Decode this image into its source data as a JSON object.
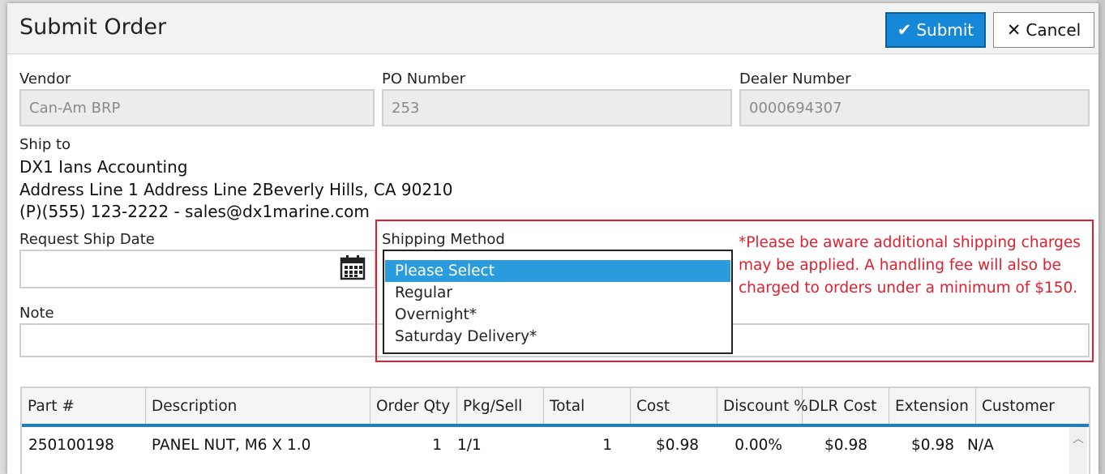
{
  "dialog": {
    "title": "Submit Order"
  },
  "buttons": {
    "submit": "Submit",
    "cancel": "Cancel"
  },
  "vendor": {
    "label": "Vendor",
    "value": "Can-Am BRP"
  },
  "po": {
    "label": "PO Number",
    "value": "253"
  },
  "dealer": {
    "label": "Dealer Number",
    "value": "0000694307"
  },
  "ship_to": {
    "label": "Ship to",
    "name": "DX1 Ians Accounting",
    "address": "Address Line 1 Address Line 2Beverly Hills, CA 90210",
    "contact": "(P)(555) 123-2222 - sales@dx1marine.com"
  },
  "request_ship_date": {
    "label": "Request Ship Date",
    "value": ""
  },
  "shipping_method": {
    "label": "Shipping Method",
    "options": [
      "Please Select",
      "Regular",
      "Overnight*",
      "Saturday Delivery*"
    ],
    "selected": "Please Select"
  },
  "notice": "*Please be aware additional shipping charges may be applied. A handling fee will also be charged to orders under a minimum of $150.",
  "note": {
    "label": "Note",
    "value": ""
  },
  "table": {
    "columns": [
      "Part #",
      "Description",
      "Order Qty",
      "Pkg/Sell",
      "Total",
      "Cost",
      "Discount %",
      "DLR Cost",
      "Extension",
      "Customer"
    ],
    "rows": [
      {
        "part": "250100198",
        "description": "PANEL NUT, M6 X 1.0",
        "order_qty": "1",
        "pkg_sell": "1/1",
        "total": "1",
        "cost": "$0.98",
        "discount": "0.00%",
        "dlr_cost": "$0.98",
        "extension": "$0.98",
        "customer": "N/A"
      }
    ]
  },
  "colors": {
    "accent": "#1588d8",
    "alert": "#e01e2e",
    "selected_option": "#2a9bdc"
  },
  "icons": {
    "submit": "checkmark-icon",
    "cancel": "close-icon",
    "calendar": "calendar-icon",
    "scroll_up": "chevron-up-icon"
  }
}
